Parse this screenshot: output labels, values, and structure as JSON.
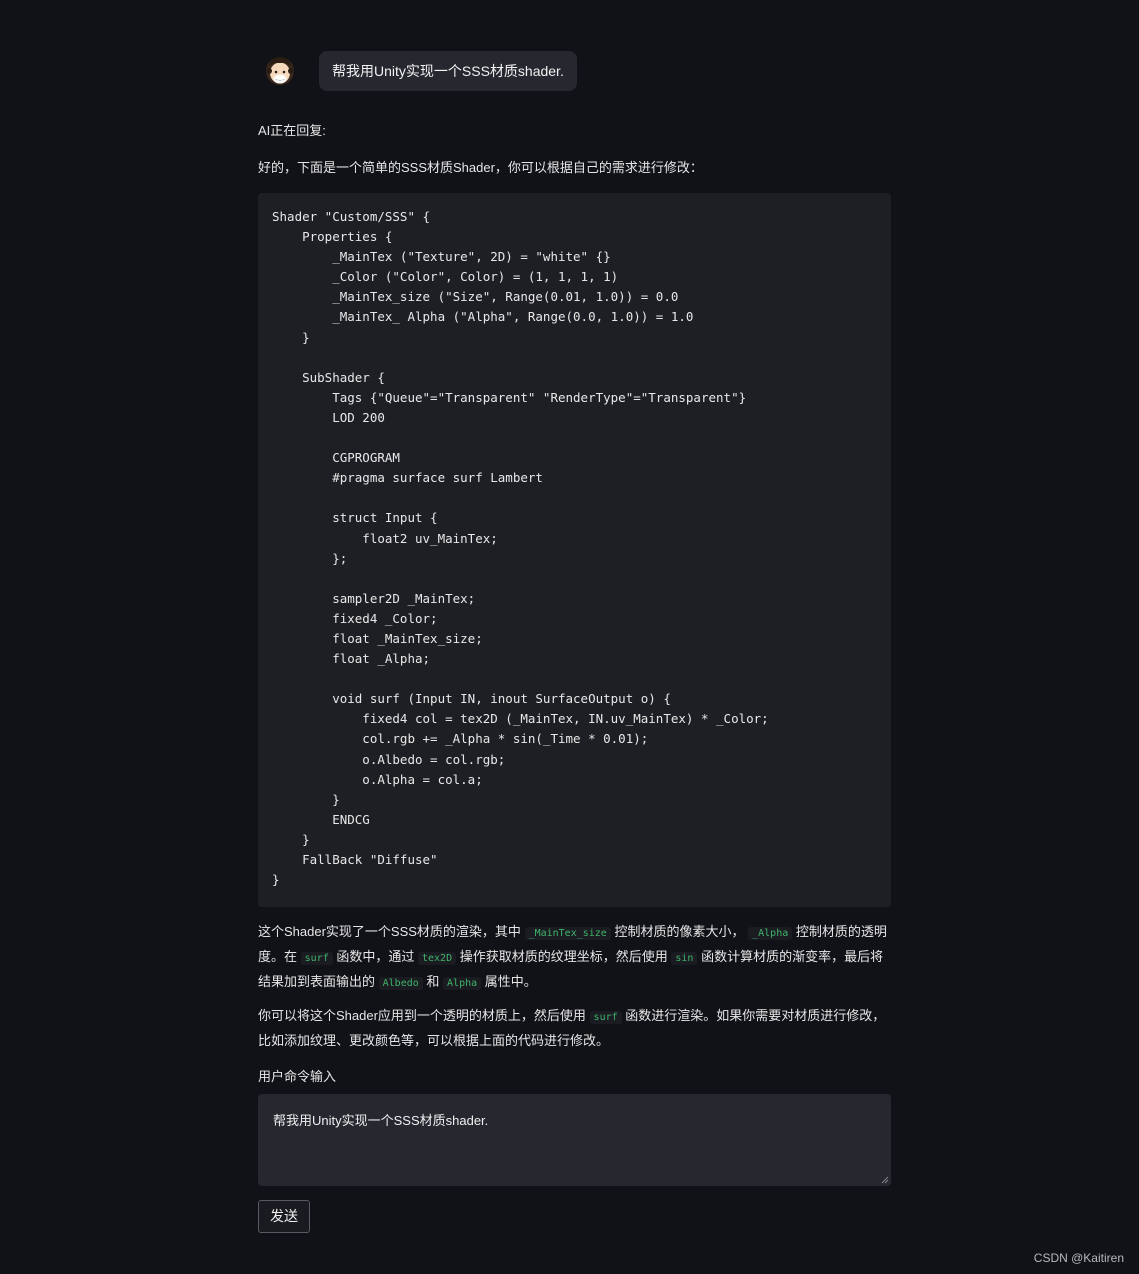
{
  "user_message": "帮我用Unity实现一个SSS材质shader.",
  "status_text": "AI正在回复:",
  "intro_text": "好的，下面是一个简单的SSS材质Shader，你可以根据自己的需求进行修改：",
  "code": "Shader \"Custom/SSS\" {\n    Properties {\n        _MainTex (\"Texture\", 2D) = \"white\" {}\n        _Color (\"Color\", Color) = (1, 1, 1, 1)\n        _MainTex_size (\"Size\", Range(0.01, 1.0)) = 0.0\n        _MainTex_ Alpha (\"Alpha\", Range(0.0, 1.0)) = 1.0\n    }\n\n    SubShader {\n        Tags {\"Queue\"=\"Transparent\" \"RenderType\"=\"Transparent\"}\n        LOD 200\n\n        CGPROGRAM\n        #pragma surface surf Lambert\n\n        struct Input {\n            float2 uv_MainTex;\n        };\n\n        sampler2D _MainTex;\n        fixed4 _Color;\n        float _MainTex_size;\n        float _Alpha;\n\n        void surf (Input IN, inout SurfaceOutput o) {\n            fixed4 col = tex2D (_MainTex, IN.uv_MainTex) * _Color;\n            col.rgb += _Alpha * sin(_Time * 0.01);\n            o.Albedo = col.rgb;\n            o.Alpha = col.a;\n        }\n        ENDCG\n    }\n    FallBack \"Diffuse\"\n}",
  "explanation": {
    "t1": "这个Shader实现了一个SSS材质的渲染，其中",
    "c1": "_MainTex_size",
    "t2": "控制材质的像素大小，",
    "c2": "_Alpha",
    "t3": "控制材质的透明度。在",
    "c3": "surf",
    "t4": "函数中，通过",
    "c4": "tex2D",
    "t5": "操作获取材质的纹理坐标，然后使用",
    "c5": "sin",
    "t6": "函数计算材质的渐变率，最后将结果加到表面输出的",
    "c6": "Albedo",
    "t7": "和",
    "c7": "Alpha",
    "t8": "属性中。"
  },
  "usage": {
    "t1": "你可以将这个Shader应用到一个透明的材质上，然后使用",
    "c1": "surf",
    "t2": "函数进行渲染。如果你需要对材质进行修改，比如添加纹理、更改颜色等，可以根据上面的代码进行修改。"
  },
  "input_label": "用户命令输入",
  "input_value": "帮我用Unity实现一个SSS材质shader.",
  "send_label": "发送",
  "watermark": "CSDN @Kaitiren",
  "colors": {
    "background": "#111218",
    "bubble": "#26272f",
    "code_bg": "#1e1f24",
    "inline_code": "#3fb36a"
  },
  "icons": {
    "avatar": "cartoon-user-avatar",
    "resize": "textarea-resize-grip"
  }
}
